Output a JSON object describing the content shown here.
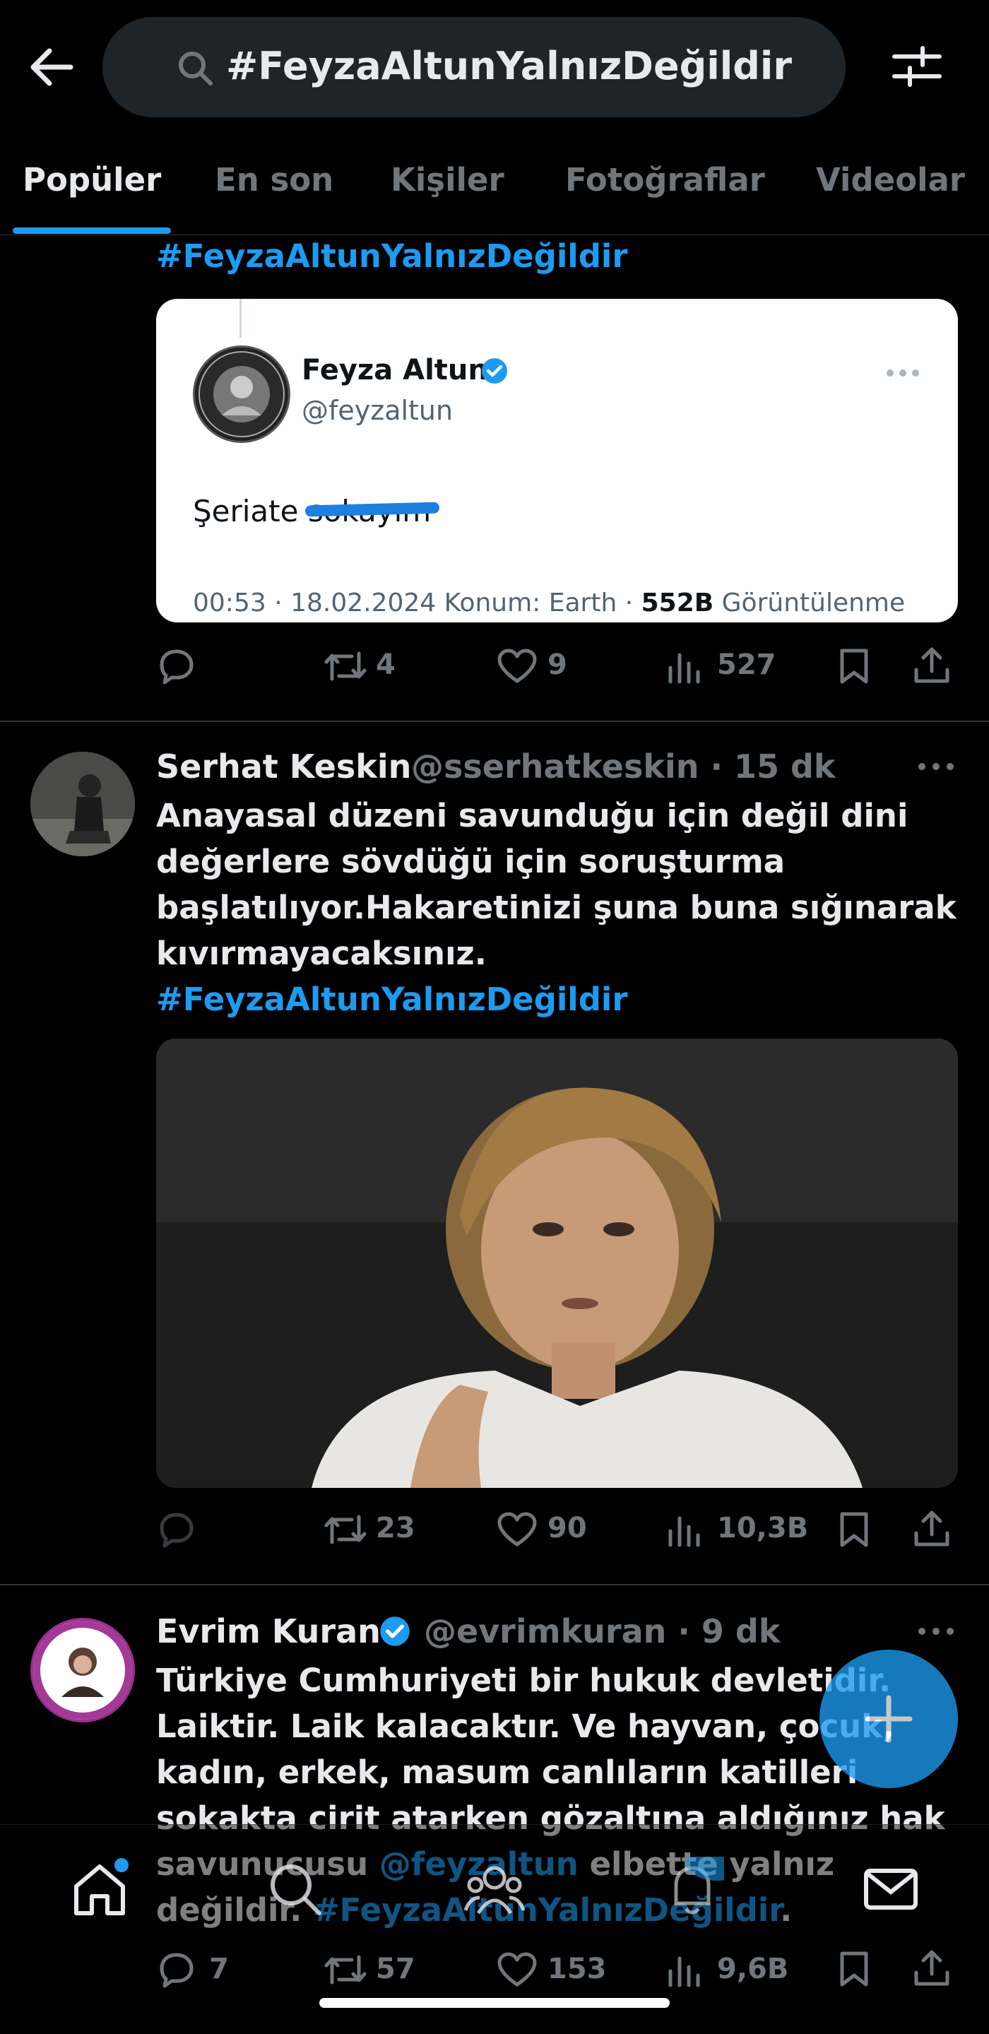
{
  "search": {
    "query": "#FeyzaAltunYalnızDeğildir"
  },
  "tabs": [
    {
      "label": "Popüler"
    },
    {
      "label": "En son"
    },
    {
      "label": "Kişiler"
    },
    {
      "label": "Fotoğraflar"
    },
    {
      "label": "Videolar"
    }
  ],
  "tweet1": {
    "hashtag": "#FeyzaAltunYalnızDeğildir",
    "embedded": {
      "name": "Feyza Altun",
      "handle": "@feyzaltun",
      "text_visible": "Şeriate",
      "text_struck": "sokayım",
      "meta_prefix": "00:53 · 18.02.2024 Konum: Earth · ",
      "views_count": "552B",
      "views_label": " Görüntülenme"
    },
    "actions": {
      "retweets": "4",
      "likes": "9",
      "views": "527"
    }
  },
  "tweet2": {
    "name": "Serhat Keskin",
    "handle": "@sserhatkeskin · 15 dk",
    "body_lines": [
      "Anayasal düzeni savunduğu için değil dini",
      "değerlere sövdüğü için soruşturma",
      "başlatılıyor.Hakaretinizi şuna buna sığınarak",
      "kıvırmayacaksınız."
    ],
    "hashtag": "#FeyzaAltunYalnızDeğildir",
    "actions": {
      "retweets": "23",
      "likes": "90",
      "views": "10,3B"
    }
  },
  "tweet3": {
    "name": "Evrim Kuran",
    "handle": "@evrimkuran · 9 dk",
    "body_lines": [
      "Türkiye Cumhuriyeti bir hukuk devletidir.",
      "Laiktir. Laik kalacaktır. Ve hayvan, çocuk,",
      "kadın, erkek, masum canlıların katilleri",
      "sokakta cirit atarken gözaltına aldığınız hak"
    ],
    "line5_prefix": "savunucusu ",
    "mention": "@feyzaltun",
    "line5_suffix": " elbette yalnız",
    "line6_prefix": "değildir. ",
    "hashtag": "#FeyzaAltunYalnızDeğildir",
    "line6_suffix": ".",
    "actions": {
      "replies": "7",
      "retweets": "57",
      "likes": "153",
      "views": "9,6B"
    }
  },
  "colors": {
    "accent": "#1d9bf0",
    "background": "#000000",
    "muted": "#71767b"
  }
}
